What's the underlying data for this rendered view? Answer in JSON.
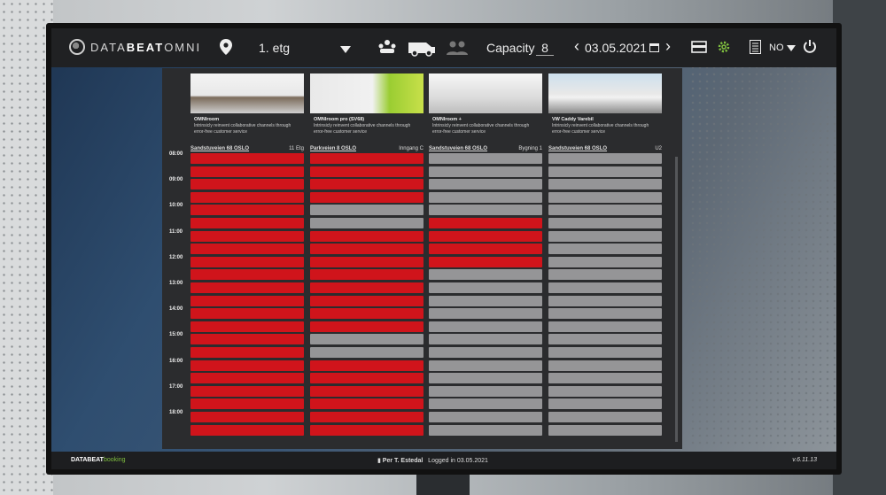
{
  "app": {
    "logo_light1": "DATA",
    "logo_bold": "BEAT",
    "logo_light2": "OMNI"
  },
  "topbar": {
    "floor": "1. etg",
    "capacity_label": "Capacity",
    "capacity_value": "8",
    "date": "03.05.2021",
    "language": "NO",
    "icons": [
      "location-pin-icon",
      "meeting-room-icon",
      "van-icon",
      "people-icon",
      "calendar-icon",
      "panel-view-icon",
      "settings-gear-icon",
      "list-icon",
      "power-icon"
    ]
  },
  "resources": [
    {
      "name": "OMNIroom",
      "desc": "Intrinsicly reinvent collaborative channels through error-free customer service",
      "address": "Sandstuveien 68 OSLO",
      "building": "11 Etg"
    },
    {
      "name": "OMNIroom pro (SV68)",
      "desc": "Intrinsicly reinvent collaborative channels through error-free customer service",
      "address": "Parkveien 8 OSLO",
      "building": "Inngang C"
    },
    {
      "name": "OMNIroom +",
      "desc": "Intrinsicly reinvent collaborative channels through error-free customer service",
      "address": "Sandstuveien 68 OSLO",
      "building": "Bygning 1"
    },
    {
      "name": "VW Caddy Varebil",
      "desc": "Intrinsicly reinvent collaborative channels through error-free customer service",
      "address": "Sandstuveien 68 OSLO",
      "building": "U2"
    }
  ],
  "times": [
    "08:00",
    "09:00",
    "10:00",
    "11:00",
    "12:00",
    "13:00",
    "14:00",
    "15:00",
    "16:00",
    "17:00",
    "18:00"
  ],
  "schedule": [
    [
      "booked",
      "booked",
      "booked",
      "booked",
      "booked",
      "booked",
      "booked",
      "booked",
      "booked",
      "booked",
      "booked",
      "booked",
      "booked",
      "booked",
      "booked",
      "booked",
      "booked",
      "booked",
      "booked",
      "booked",
      "booked",
      "booked"
    ],
    [
      "booked",
      "booked",
      "booked",
      "booked",
      "free",
      "free",
      "booked",
      "booked",
      "booked",
      "booked",
      "booked",
      "booked",
      "booked",
      "booked",
      "free",
      "free",
      "booked",
      "booked",
      "booked",
      "booked",
      "booked",
      "booked"
    ],
    [
      "free",
      "free",
      "free",
      "free",
      "free",
      "booked",
      "booked",
      "booked",
      "booked",
      "free",
      "free",
      "free",
      "free",
      "free",
      "free",
      "free",
      "free",
      "free",
      "free",
      "free",
      "free",
      "free"
    ],
    [
      "free",
      "free",
      "free",
      "free",
      "free",
      "free",
      "free",
      "free",
      "free",
      "free",
      "free",
      "free",
      "free",
      "free",
      "free",
      "free",
      "free",
      "free",
      "free",
      "free",
      "free",
      "free"
    ]
  ],
  "colors": {
    "booked": "#d0141b",
    "free": "#959597",
    "accent": "#7fbf3f"
  },
  "footer": {
    "brand_bold": "DATABEAT",
    "brand_accent": "booking",
    "user": "Per T. Estedal",
    "logged_in": "Logged in 03.05.2021",
    "version": "v.6.11.13"
  }
}
